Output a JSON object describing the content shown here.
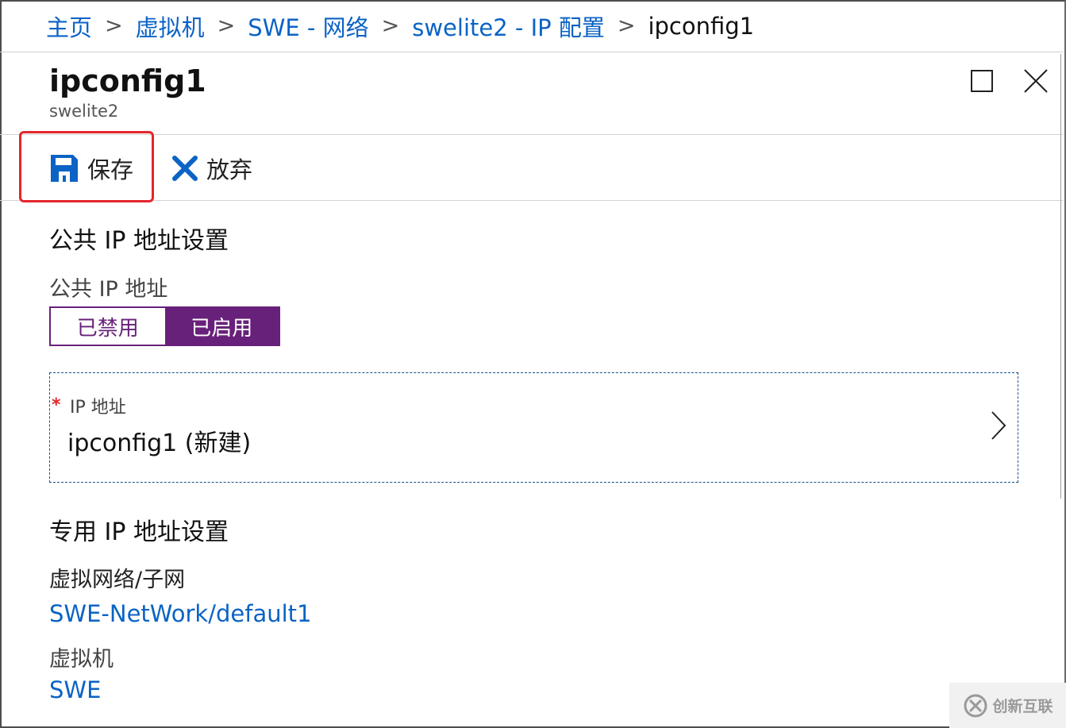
{
  "breadcrumb": {
    "items": [
      "主页",
      "虚拟机",
      "SWE - 网络",
      "swelite2 - IP 配置"
    ],
    "current": "ipconfig1",
    "separator": ">"
  },
  "header": {
    "title": "ipconfig1",
    "subtitle": "swelite2"
  },
  "toolbar": {
    "save_label": "保存",
    "discard_label": "放弃"
  },
  "public_ip": {
    "section_title": "公共 IP 地址设置",
    "field_label": "公共 IP 地址",
    "toggle": {
      "off_label": "已禁用",
      "on_label": "已启用",
      "selected": "已启用"
    },
    "ip_address": {
      "required_mark": "*",
      "label": "IP 地址",
      "value": "ipconfig1 (新建)"
    }
  },
  "private_ip": {
    "section_title": "专用 IP 地址设置",
    "vnet_label": "虚拟网络/子网",
    "vnet_value": "SWE-NetWork/default1",
    "vm_label": "虚拟机",
    "vm_value": "SWE"
  },
  "watermark": {
    "text": "创新互联"
  },
  "colors": {
    "link": "#0b63c5",
    "accent_purple": "#68217a",
    "highlight_red": "#e3262b",
    "save_icon": "#0b63c5",
    "discard_icon": "#0b63c5"
  },
  "icons": [
    "save-icon",
    "discard-x-icon",
    "maximize-icon",
    "close-icon",
    "chevron-right-icon",
    "watermark-logo-icon"
  ]
}
